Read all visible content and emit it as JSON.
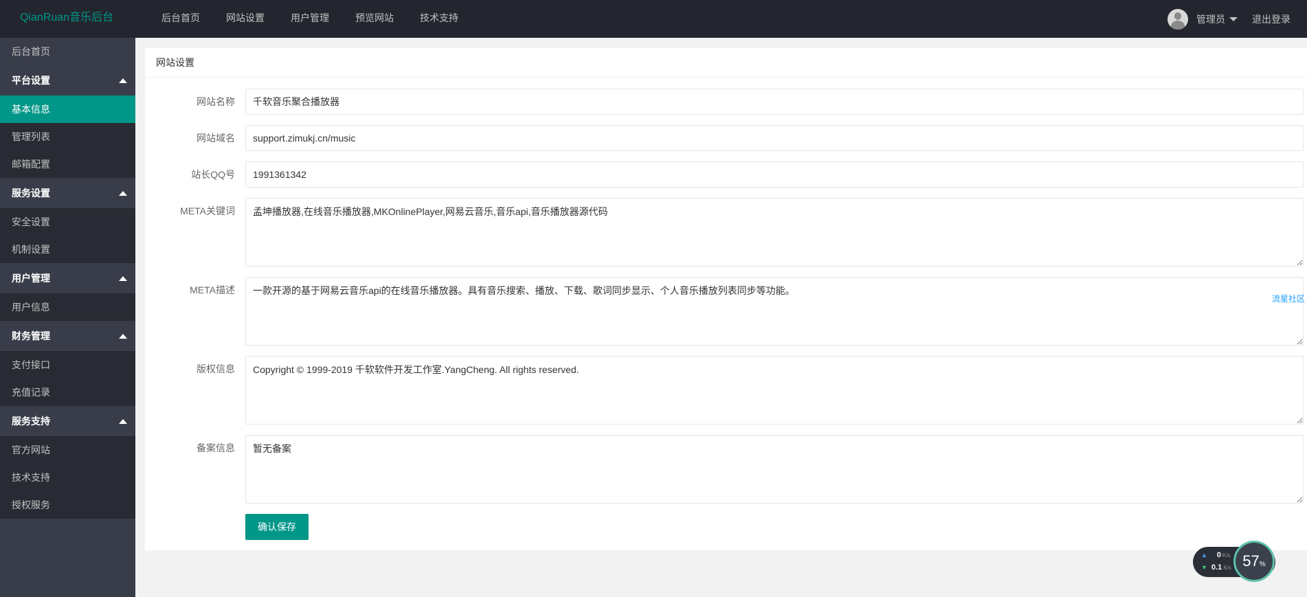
{
  "header": {
    "logo": "QianRuan音乐后台",
    "nav": [
      "后台首页",
      "网站设置",
      "用户管理",
      "预览网站",
      "技术支持"
    ],
    "user_name": "管理员",
    "logout": "退出登录"
  },
  "sidebar": {
    "home": "后台首页",
    "groups": [
      {
        "title": "平台设置",
        "items": [
          "基本信息",
          "管理列表",
          "邮箱配置"
        ]
      },
      {
        "title": "服务设置",
        "items": [
          "安全设置",
          "机制设置"
        ]
      },
      {
        "title": "用户管理",
        "items": [
          "用户信息"
        ]
      },
      {
        "title": "财务管理",
        "items": [
          "支付接口",
          "充值记录"
        ]
      },
      {
        "title": "服务支持",
        "items": [
          "官方网站",
          "技术支持",
          "授权服务"
        ]
      }
    ],
    "active_item": "基本信息"
  },
  "main": {
    "card_title": "网站设置",
    "fields": {
      "site_name": {
        "label": "网站名称",
        "value": "千软音乐聚合播放器"
      },
      "site_domain": {
        "label": "网站域名",
        "value": "support.zimukj.cn/music"
      },
      "admin_qq": {
        "label": "站长QQ号",
        "value": "1991361342"
      },
      "meta_keywords": {
        "label": "META关键词",
        "value": "孟坤播放器,在线音乐播放器,MKOnlinePlayer,网易云音乐,音乐api,音乐播放器源代码"
      },
      "meta_description": {
        "label": "META描述",
        "value": "一款开源的基于网易云音乐api的在线音乐播放器。具有音乐搜索、播放、下载、歌词同步显示、个人音乐播放列表同步等功能。"
      },
      "copyright": {
        "label": "版权信息",
        "value": "Copyright © 1999-2019 千软软件开发工作室.YangCheng. All rights reserved."
      },
      "icp": {
        "label": "备案信息",
        "value": "暂无备案"
      }
    },
    "save_button": "确认保存",
    "side_link": "流星社区"
  },
  "net_widget": {
    "upload": "0",
    "download": "0.1",
    "unit": "K/s",
    "percent": "57",
    "percent_sign": "%"
  }
}
